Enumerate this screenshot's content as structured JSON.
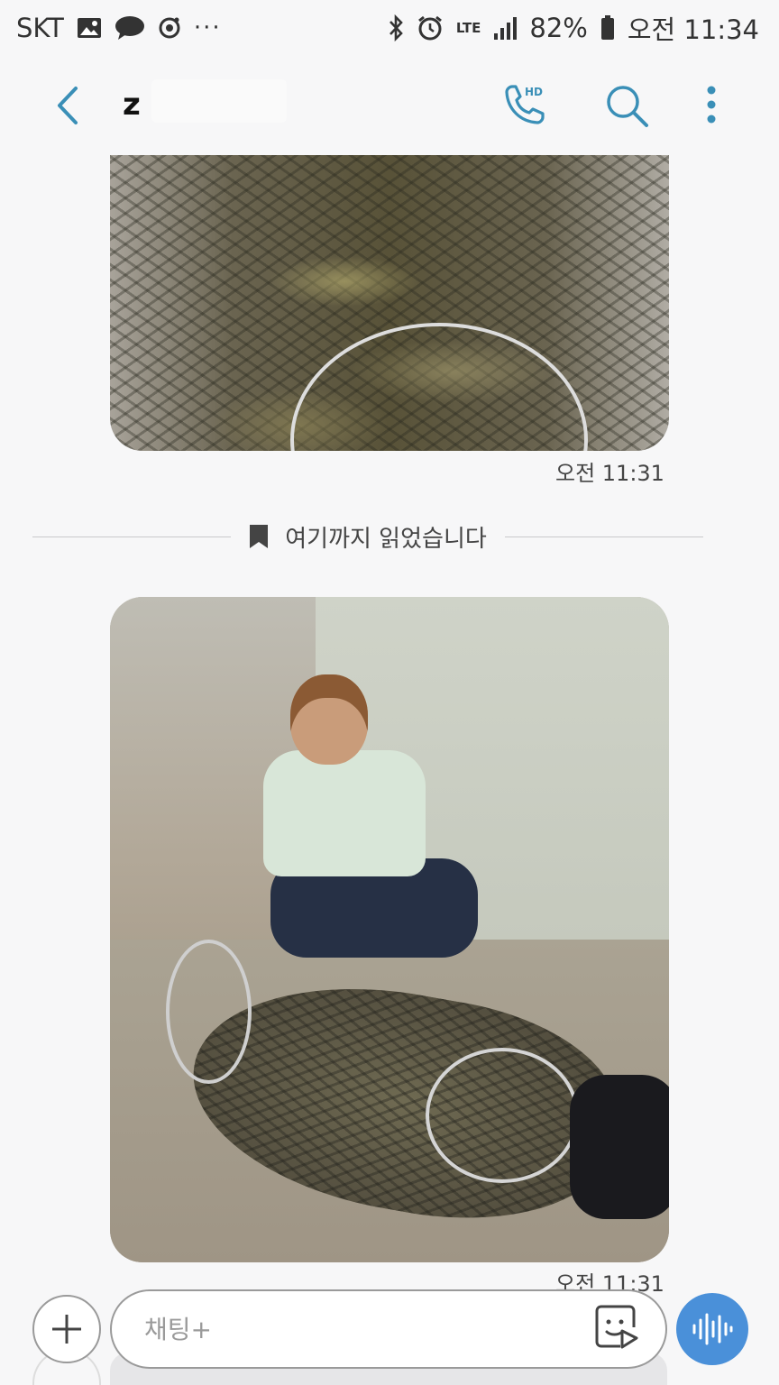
{
  "status_bar": {
    "carrier": "SKT",
    "network": "LTE",
    "battery": "82%",
    "time": "오전 11:34",
    "dots": "···"
  },
  "header": {
    "contact_name": "z",
    "accent_color": "#3a8fb7"
  },
  "messages": [
    {
      "type": "image",
      "timestamp": "오전 11:31"
    },
    {
      "type": "image",
      "timestamp": "오전 11:31"
    }
  ],
  "divider": {
    "label": "여기까지 읽었습니다"
  },
  "input": {
    "placeholder": "채팅+"
  },
  "icons": {
    "back": "chevron-left-icon",
    "call": "hd-call-icon",
    "search": "search-icon",
    "more": "more-vertical-icon",
    "bookmark": "bookmark-icon",
    "add": "plus-icon",
    "sticker": "sticker-icon",
    "voice": "voice-wave-icon"
  }
}
